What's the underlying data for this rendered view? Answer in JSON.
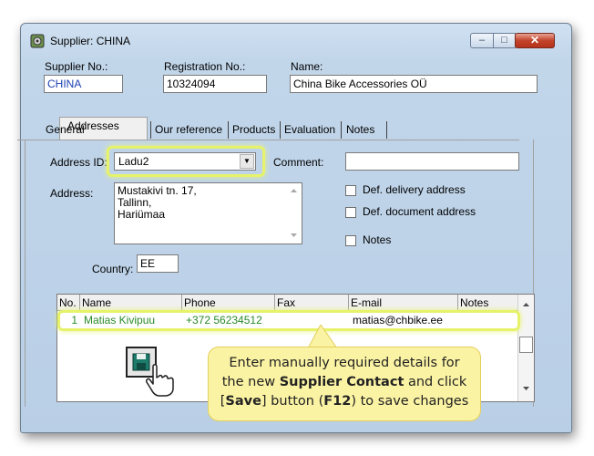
{
  "window": {
    "title": "Supplier: CHINA",
    "controls": {
      "minimize": "–",
      "maximize": "□",
      "close": "✕"
    }
  },
  "header": {
    "supplier_no_label": "Supplier No.:",
    "supplier_no_value": "CHINA",
    "registration_no_label": "Registration No.:",
    "registration_no_value": "10324094",
    "name_label": "Name:",
    "name_value": "China Bike Accessories OÜ"
  },
  "tabs": [
    {
      "label": "General"
    },
    {
      "label": "Addresses",
      "selected": true
    },
    {
      "label": "Our reference"
    },
    {
      "label": "Products"
    },
    {
      "label": "Evaluation"
    },
    {
      "label": "Notes"
    }
  ],
  "addresses": {
    "address_id_label": "Address ID:",
    "address_id_value": "Ladu2",
    "comment_label": "Comment:",
    "comment_value": "",
    "address_label": "Address:",
    "address_lines": [
      "Mustakivi tn. 17,",
      "Tallinn,",
      "Hariümaa"
    ],
    "country_label": "Country:",
    "country_value": "EE",
    "checkboxes": [
      {
        "label": "Def. delivery address",
        "checked": false
      },
      {
        "label": "Def. document address",
        "checked": false
      },
      {
        "label": "Notes",
        "checked": false
      }
    ]
  },
  "contacts_table": {
    "columns": [
      "No.",
      "Name",
      "Phone",
      "Fax",
      "E-mail",
      "Notes"
    ],
    "rows": [
      {
        "no": "1",
        "name": "Matias Kivipuu",
        "phone": "+372 56234512",
        "fax": "",
        "email": "matias@chbike.ee",
        "notes": ""
      }
    ]
  },
  "callout": {
    "line1": "Enter manually required details for",
    "line2_pre": "the new ",
    "line2_bold": "Supplier Contact",
    "line2_post": " and click",
    "line3_pre": "[",
    "line3_bold1": "Save",
    "line3_mid": "] button (",
    "line3_bold2": "F12",
    "line3_post": ") to save changes"
  },
  "icons": {
    "app": "application-icon",
    "save": "floppy-disk-save-icon",
    "cursor": "hand-pointer-icon"
  },
  "colors": {
    "highlight": "#e6f26a",
    "callout_bg": "#fbf3a4",
    "row_text": "#2a8a2a",
    "supplier_no_text": "#1a3fb0"
  }
}
